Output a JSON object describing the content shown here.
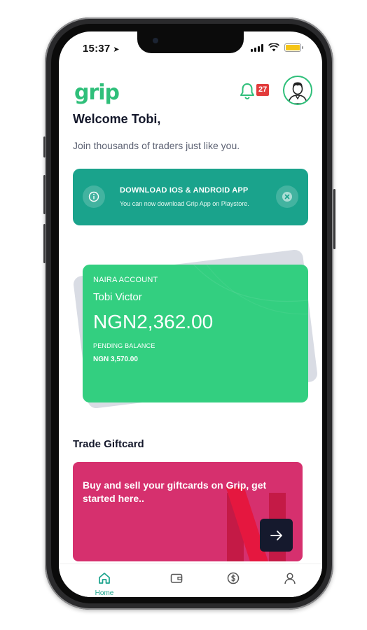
{
  "status_bar": {
    "time": "15:37"
  },
  "header": {
    "logo_text": "grip",
    "notification_count": "27"
  },
  "welcome": {
    "title": "Welcome Tobi,",
    "subtitle": "Join thousands of traders just like you."
  },
  "banner": {
    "title": "DOWNLOAD IOS & ANDROID APP",
    "text": "You can now download Grip App on Playstore."
  },
  "account_card": {
    "label": "NAIRA ACCOUNT",
    "name": "Tobi Victor",
    "balance": "NGN2,362.00",
    "pending_label": "PENDING BALANCE",
    "pending_value": "NGN 3,570.00"
  },
  "trade": {
    "section_title": "Trade Giftcard",
    "promo_text": "Buy and sell your giftcards on Grip, get started here.."
  },
  "tabbar": {
    "items": [
      {
        "label": "Home",
        "icon": "home-icon",
        "active": true
      },
      {
        "label": "",
        "icon": "wallet-icon",
        "active": false
      },
      {
        "label": "",
        "icon": "dollar-icon",
        "active": false
      },
      {
        "label": "",
        "icon": "profile-icon",
        "active": false
      }
    ]
  },
  "colors": {
    "brand_green": "#2fbf7a",
    "teal": "#1aa38c",
    "card_green": "#33cf80",
    "gift_pink": "#d6306e",
    "dark_navy": "#15192d",
    "badge_red": "#e23b3b"
  }
}
